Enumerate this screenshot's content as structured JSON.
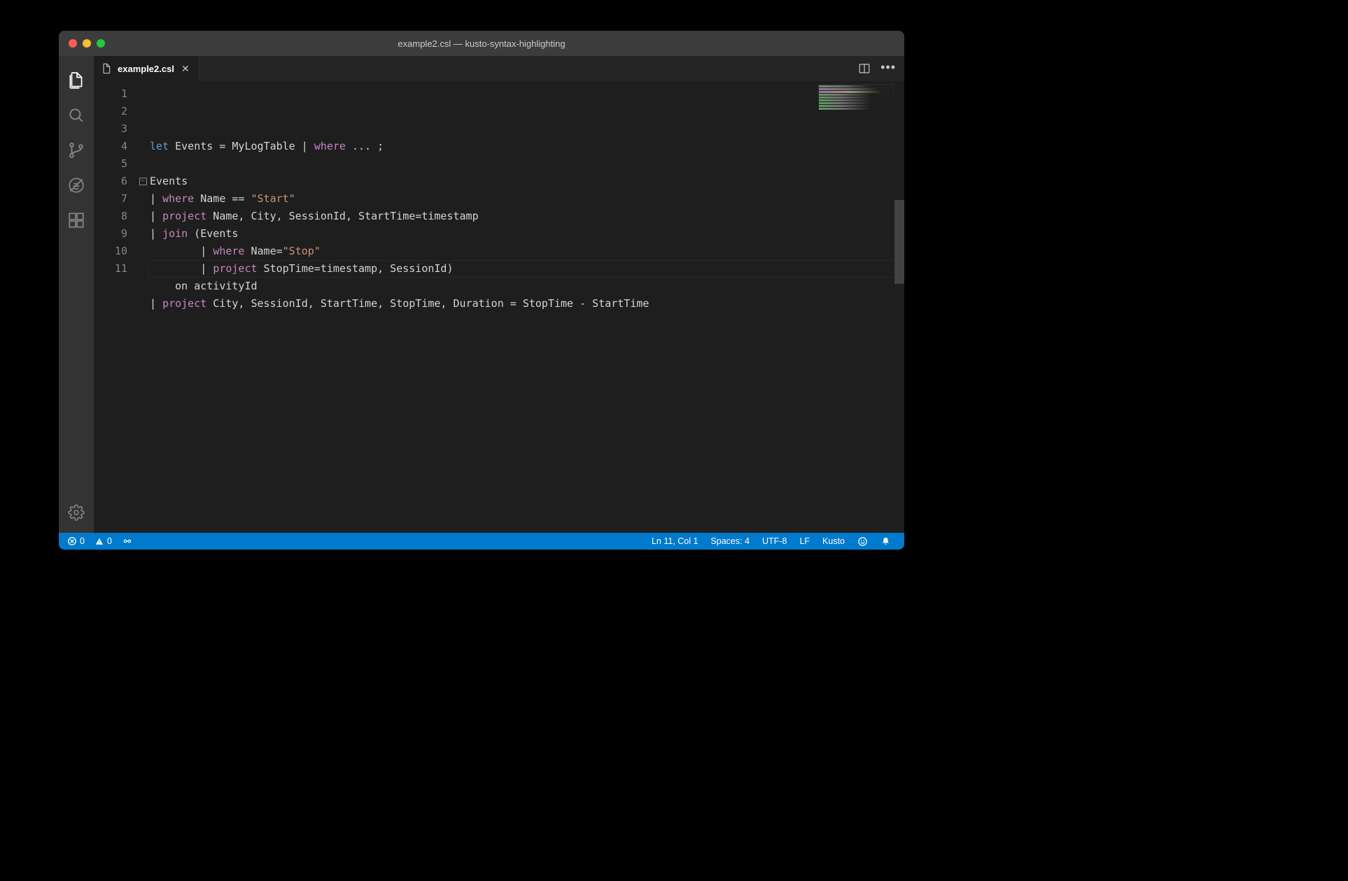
{
  "colors": {
    "traffic": {
      "close": "#ff5f57",
      "min": "#febc2e",
      "max": "#28c840"
    },
    "statusbar": "#007acc"
  },
  "titlebar": {
    "title": "example2.csl — kusto-syntax-highlighting"
  },
  "tab": {
    "filename": "example2.csl"
  },
  "editor": {
    "lineNumbers": [
      "1",
      "2",
      "3",
      "4",
      "5",
      "6",
      "7",
      "8",
      "9",
      "10",
      "11"
    ],
    "foldAt": 6,
    "lines": [
      [
        {
          "c": "kw-let",
          "t": "let"
        },
        {
          "c": "ident",
          "t": " Events "
        },
        {
          "c": "punct",
          "t": "= MyLogTable "
        },
        {
          "c": "punct",
          "t": "| "
        },
        {
          "c": "kw-op",
          "t": "where"
        },
        {
          "c": "punct",
          "t": " ... ;"
        }
      ],
      [
        {
          "c": "ident",
          "t": ""
        }
      ],
      [
        {
          "c": "ident",
          "t": "Events"
        }
      ],
      [
        {
          "c": "punct",
          "t": "| "
        },
        {
          "c": "kw-op",
          "t": "where"
        },
        {
          "c": "ident",
          "t": " Name "
        },
        {
          "c": "punct",
          "t": "== "
        },
        {
          "c": "str",
          "t": "\"Start\""
        }
      ],
      [
        {
          "c": "punct",
          "t": "| "
        },
        {
          "c": "kw-op",
          "t": "project"
        },
        {
          "c": "ident",
          "t": " Name, City, SessionId, StartTime=timestamp"
        }
      ],
      [
        {
          "c": "punct",
          "t": "| "
        },
        {
          "c": "kw-op",
          "t": "join"
        },
        {
          "c": "punct",
          "t": " (Events"
        }
      ],
      [
        {
          "c": "punct",
          "t": "        | "
        },
        {
          "c": "kw-op",
          "t": "where"
        },
        {
          "c": "ident",
          "t": " Name="
        },
        {
          "c": "str",
          "t": "\"Stop\""
        }
      ],
      [
        {
          "c": "punct",
          "t": "        | "
        },
        {
          "c": "kw-op",
          "t": "project"
        },
        {
          "c": "ident",
          "t": " StopTime=timestamp, SessionId)"
        }
      ],
      [
        {
          "c": "ident",
          "t": "    on activityId"
        }
      ],
      [
        {
          "c": "punct",
          "t": "| "
        },
        {
          "c": "kw-op",
          "t": "project"
        },
        {
          "c": "ident",
          "t": " City, SessionId, StartTime, StopTime, Duration = StopTime - StartTime"
        }
      ],
      [
        {
          "c": "ident",
          "t": ""
        }
      ]
    ]
  },
  "statusbar": {
    "errors": "0",
    "warnings": "0",
    "cursor": "Ln 11, Col 1",
    "indent": "Spaces: 4",
    "encoding": "UTF-8",
    "eol": "LF",
    "language": "Kusto"
  }
}
